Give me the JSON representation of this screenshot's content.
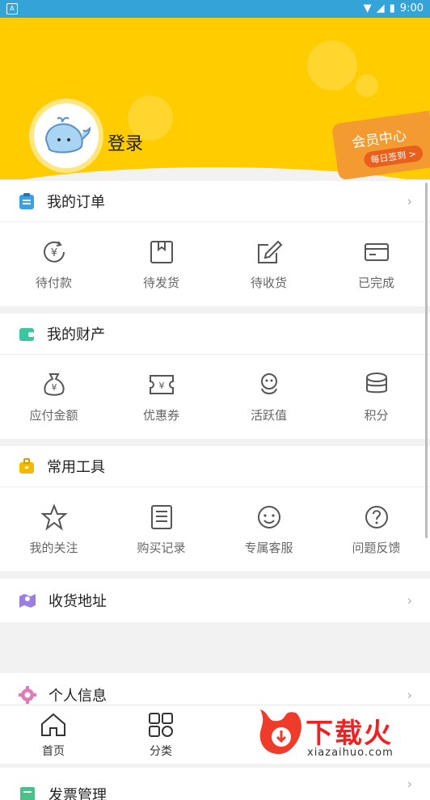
{
  "status_bar": {
    "time": "9:00"
  },
  "header": {
    "login_label": "登录",
    "vip_title": "会员中心",
    "vip_checkin": "每日签到 >"
  },
  "orders": {
    "title": "我的订单",
    "items": [
      {
        "label": "待付款",
        "icon": "pending-payment-icon"
      },
      {
        "label": "待发货",
        "icon": "pending-shipment-icon"
      },
      {
        "label": "待收货",
        "icon": "pending-receipt-icon"
      },
      {
        "label": "已完成",
        "icon": "completed-icon"
      }
    ]
  },
  "assets": {
    "title": "我的财产",
    "items": [
      {
        "label": "应付金额",
        "icon": "money-bag-icon"
      },
      {
        "label": "优惠券",
        "icon": "coupon-icon"
      },
      {
        "label": "活跃值",
        "icon": "activity-icon"
      },
      {
        "label": "积分",
        "icon": "coins-icon"
      }
    ]
  },
  "tools": {
    "title": "常用工具",
    "items": [
      {
        "label": "我的关注",
        "icon": "star-icon"
      },
      {
        "label": "购买记录",
        "icon": "receipt-icon"
      },
      {
        "label": "专属客服",
        "icon": "smile-icon"
      },
      {
        "label": "问题反馈",
        "icon": "question-icon"
      }
    ]
  },
  "rows": [
    {
      "label": "收货地址",
      "icon": "map-icon"
    },
    {
      "label": "个人信息",
      "icon": "gear-icon"
    },
    {
      "label": "发票管理",
      "icon": "invoice-icon"
    }
  ],
  "tabbar": {
    "home": "首页",
    "category": "分类"
  },
  "watermark": {
    "brand": "下载火",
    "url": "xiazaihuo.com"
  },
  "colors": {
    "accent": "#ffcc00",
    "status_bar": "#34a3d8",
    "vip_badge": "#f39a30"
  }
}
